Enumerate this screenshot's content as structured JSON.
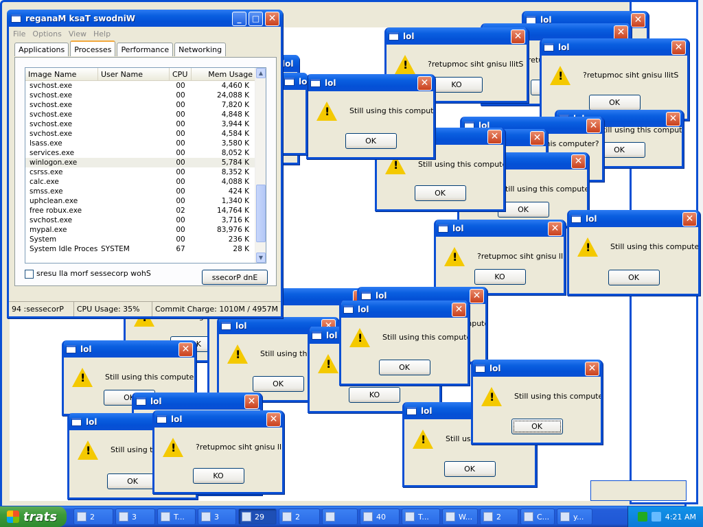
{
  "dialog_title": "lol",
  "dialog_message": "Still using this computer?",
  "dialog_message_reversed": "?retupmoc siht gnisu llitS",
  "ok_label": "OK",
  "ok_label_reversed": "KO",
  "task_manager": {
    "title": "reganaM ksaT swodniW",
    "menu": [
      "File",
      "Options",
      "View",
      "Help"
    ],
    "tabs": [
      "Applications",
      "Processes",
      "Performance",
      "Networking"
    ],
    "selected_tab": "Processes",
    "columns": [
      "Image Name",
      "User Name",
      "CPU",
      "Mem Usage"
    ],
    "processes": [
      [
        "svchost.exe",
        "",
        "00",
        "4,460 K"
      ],
      [
        "svchost.exe",
        "",
        "00",
        "24,088 K"
      ],
      [
        "svchost.exe",
        "",
        "00",
        "7,820 K"
      ],
      [
        "svchost.exe",
        "",
        "00",
        "4,848 K"
      ],
      [
        "svchost.exe",
        "",
        "00",
        "3,944 K"
      ],
      [
        "svchost.exe",
        "",
        "00",
        "4,584 K"
      ],
      [
        "lsass.exe",
        "",
        "00",
        "3,580 K"
      ],
      [
        "services.exe",
        "",
        "00",
        "8,052 K"
      ],
      [
        "winlogon.exe",
        "",
        "00",
        "5,784 K"
      ],
      [
        "csrss.exe",
        "",
        "00",
        "8,352 K"
      ],
      [
        "calc.exe",
        "",
        "00",
        "4,088 K"
      ],
      [
        "smss.exe",
        "",
        "00",
        "424 K"
      ],
      [
        "uphclean.exe",
        "",
        "00",
        "1,340 K"
      ],
      [
        "free robux.exe",
        "",
        "02",
        "14,764 K"
      ],
      [
        "svchost.exe",
        "",
        "00",
        "3,716 K"
      ],
      [
        "mypal.exe",
        "",
        "00",
        "83,976 K"
      ],
      [
        "System",
        "",
        "00",
        "236 K"
      ],
      [
        "System Idle Process",
        "SYSTEM",
        "67",
        "28 K"
      ]
    ],
    "show_all_label": "sresu lla morf sessecorp wohS",
    "end_process_label": "ssecorP dnE",
    "status_processes": "94 :sessecorP",
    "status_cpu": "CPU Usage: 35%",
    "status_commit": "Commit Charge: 1010M / 4957M"
  },
  "taskbar": {
    "start_label": "trats",
    "buttons": [
      "2",
      "3",
      "T...",
      "3",
      "29",
      "2",
      "",
      "40",
      "T...",
      "W...",
      "2",
      "C...",
      "y..."
    ],
    "clock": "4:21 AM"
  }
}
